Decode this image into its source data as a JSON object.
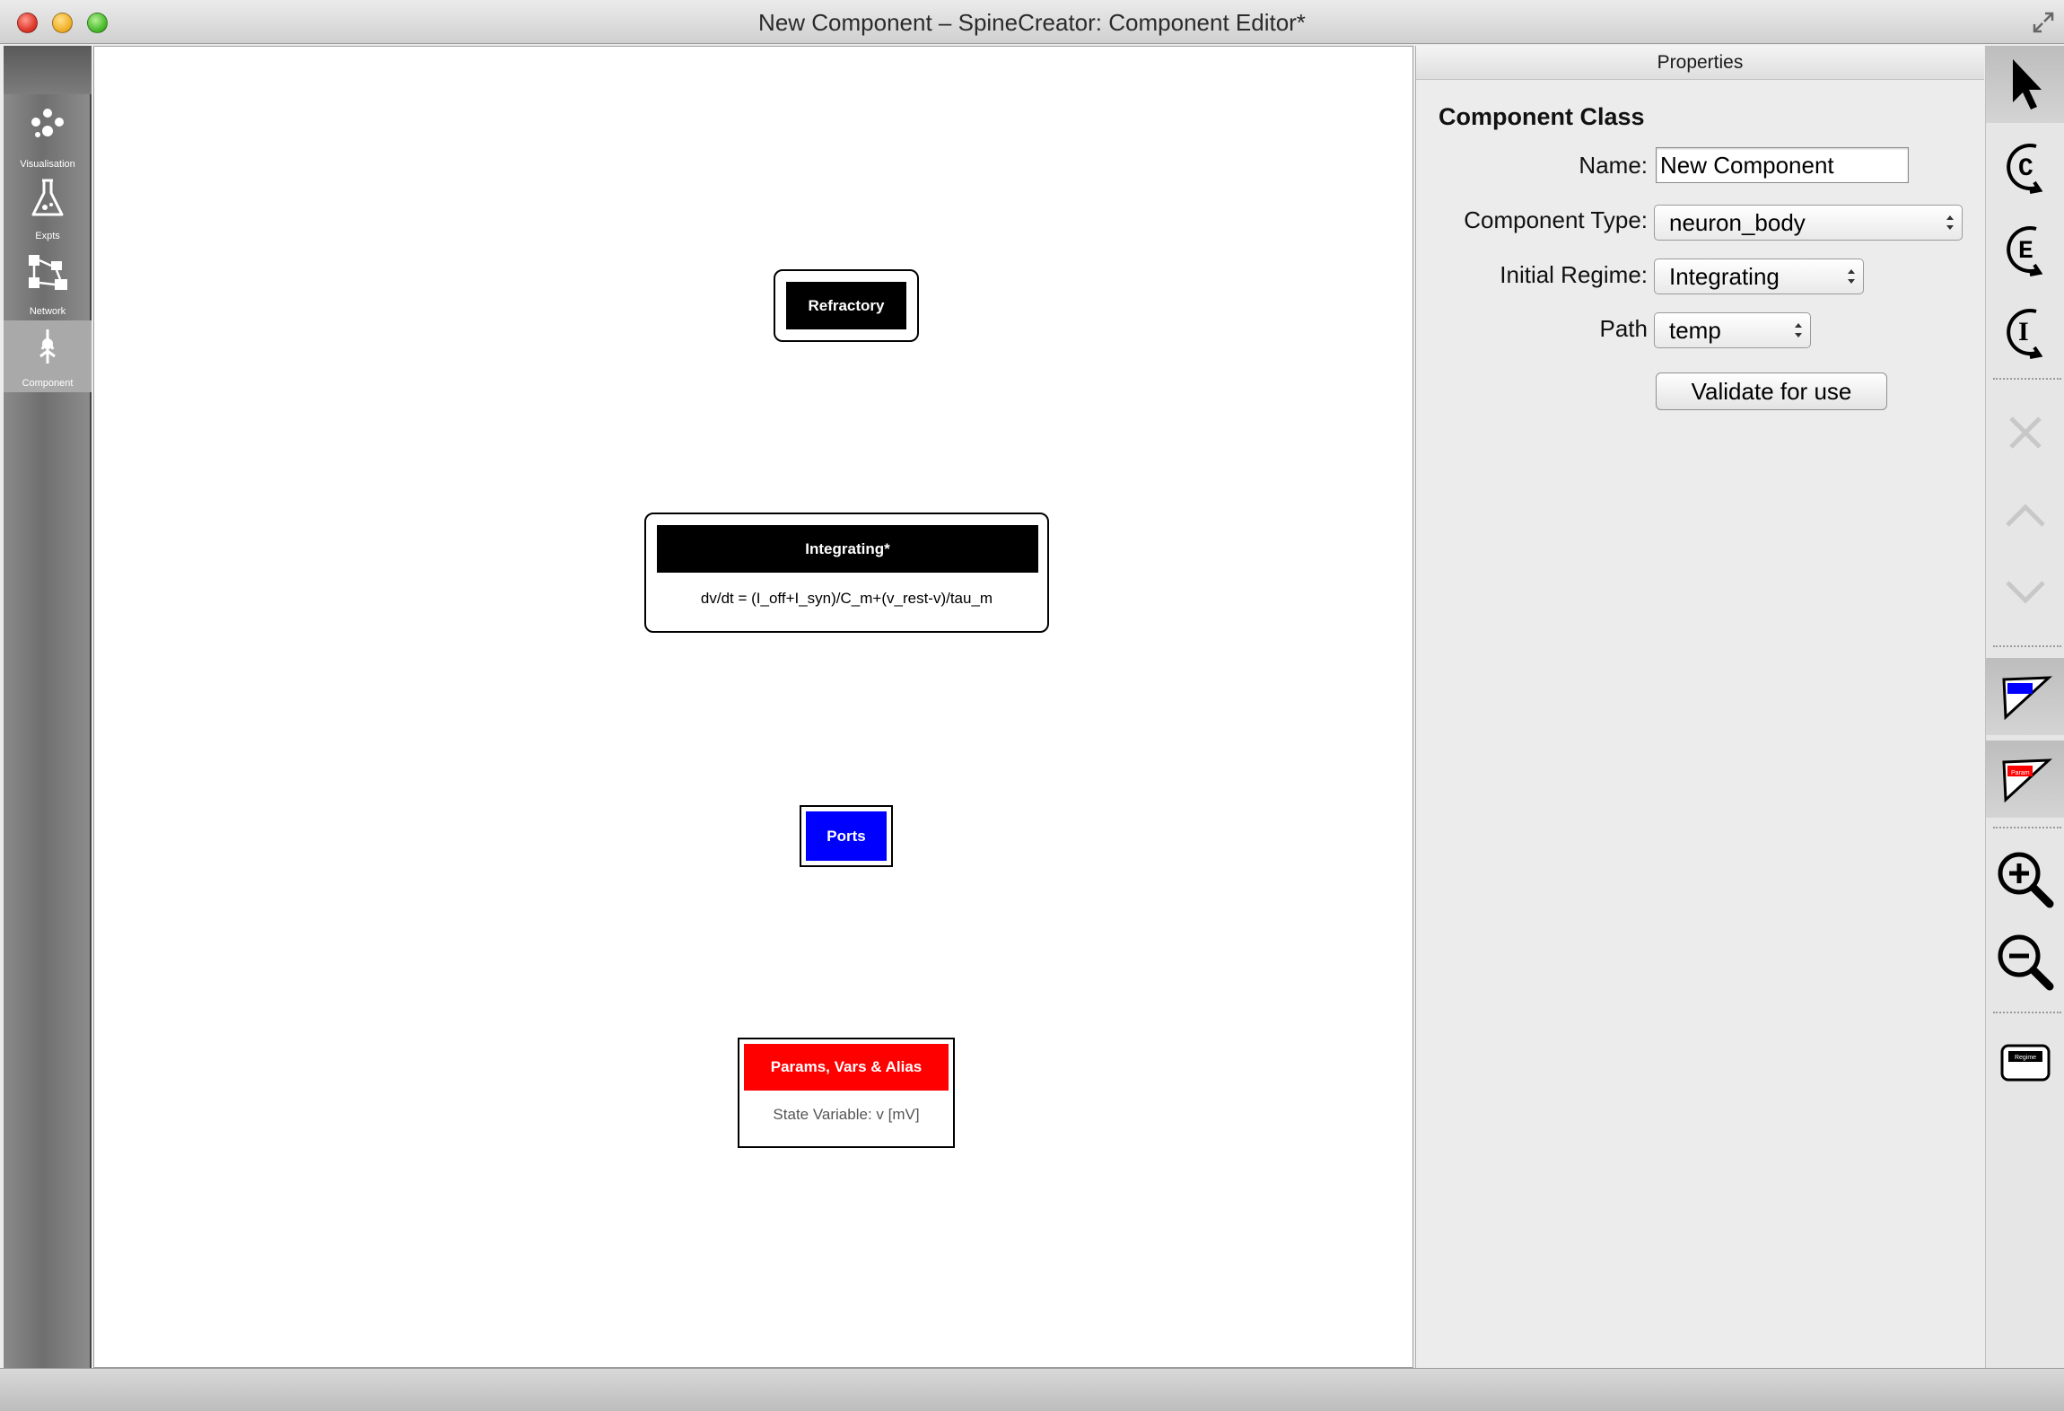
{
  "window": {
    "title": "New Component – SpineCreator: Component Editor*"
  },
  "sidenav": {
    "items": [
      {
        "label": "Visualisation",
        "icon": "visualisation-icon"
      },
      {
        "label": "Expts",
        "icon": "flask-icon"
      },
      {
        "label": "Network",
        "icon": "network-icon"
      },
      {
        "label": "Component",
        "icon": "component-icon",
        "active": true
      }
    ]
  },
  "canvas": {
    "refractory": {
      "title": "Refractory"
    },
    "integrating": {
      "title": "Integrating*",
      "equation": "dv/dt = (I_off+I_syn)/C_m+(v_rest-v)/tau_m"
    },
    "ports": {
      "title": "Ports",
      "color": "#0000ff"
    },
    "params": {
      "title": "Params, Vars & Alias",
      "color": "#ff0000",
      "body": "State Variable: v [mV]"
    }
  },
  "properties": {
    "panel_title": "Properties",
    "heading": "Component Class",
    "name_label": "Name:",
    "name_value": "New Component",
    "type_label": "Component Type:",
    "type_value": "neuron_body",
    "regime_label": "Initial Regime:",
    "regime_value": "Integrating",
    "path_label": "Path",
    "path_value": "temp",
    "validate_label": "Validate for use"
  },
  "toolbar": {
    "tools": [
      "select-pointer-icon",
      "add-component-icon",
      "add-event-icon",
      "add-impulse-icon",
      "delete-icon",
      "move-up-icon",
      "move-down-icon",
      "add-port-icon",
      "add-parameter-icon",
      "zoom-in-icon",
      "zoom-out-icon",
      "add-regime-icon"
    ],
    "regime_tool_text": "Regime",
    "param_tool_text": "Param"
  },
  "colors": {
    "ports": "#0000ff",
    "params": "#ff0000"
  }
}
